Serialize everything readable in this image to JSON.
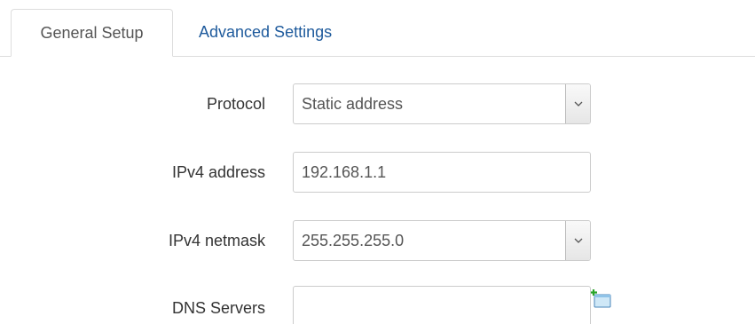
{
  "tabs": [
    {
      "label": "General Setup",
      "active": true
    },
    {
      "label": "Advanced Settings",
      "active": false
    }
  ],
  "form": {
    "protocol": {
      "label": "Protocol",
      "value": "Static address"
    },
    "ipv4_address": {
      "label": "IPv4 address",
      "value": "192.168.1.1"
    },
    "ipv4_netmask": {
      "label": "IPv4 netmask",
      "value": "255.255.255.0"
    },
    "dns_servers": {
      "label": "DNS Servers",
      "value": "",
      "add_icon": "add-entry-icon"
    }
  },
  "colors": {
    "tab_link": "#1e5a9c",
    "tab_active_text": "#555555",
    "label_text": "#333333",
    "border": "#cccccc",
    "add_icon_green": "#2aa52a"
  }
}
